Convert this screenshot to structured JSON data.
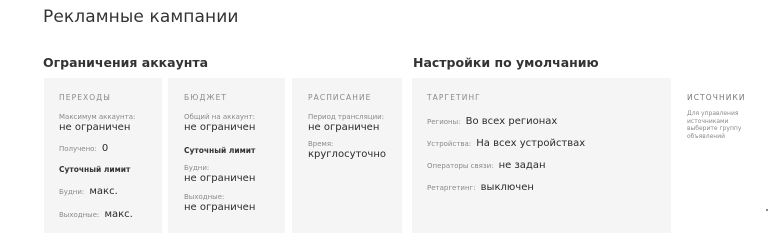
{
  "page_title": "Рекламные кампании",
  "account_limits": {
    "title": "Ограничения аккаунта",
    "transitions": {
      "header": "ПЕРЕХОДЫ",
      "max_label": "Максимум аккаунта:",
      "max_value": "не ограничен",
      "received_label": "Получено:",
      "received_value": "0",
      "daily_limit": "Суточный лимит",
      "weekdays_label": "Будни:",
      "weekdays_value": "макс.",
      "weekends_label": "Выходные:",
      "weekends_value": "макс."
    },
    "budget": {
      "header": "БЮДЖЕТ",
      "total_label": "Общий на аккаунт:",
      "total_value": "не ограничен",
      "daily_limit": "Суточный лимит",
      "weekdays_label": "Будни:",
      "weekdays_value": "не ограничен",
      "weekends_label": "Выходные:",
      "weekends_value": "не ограничен"
    },
    "schedule": {
      "header": "РАСПИСАНИЕ",
      "period_label": "Период трансляции:",
      "period_value": "не ограничен",
      "time_label": "Время:",
      "time_value": "круглосуточно"
    }
  },
  "default_settings": {
    "title": "Настройки по умолчанию",
    "targeting": {
      "header": "ТАРГЕТИНГ",
      "regions_label": "Регионы:",
      "regions_value": "Во всех регионах",
      "devices_label": "Устройства:",
      "devices_value": "На всех устройствах",
      "operators_label": "Операторы связи:",
      "operators_value": "не задан",
      "retargeting_label": "Ретаргетинг:",
      "retargeting_value": "выключен"
    },
    "sources": {
      "header": "ИСТОЧНИКИ",
      "description": "Для управления источниками выберите группу объявлений"
    }
  }
}
